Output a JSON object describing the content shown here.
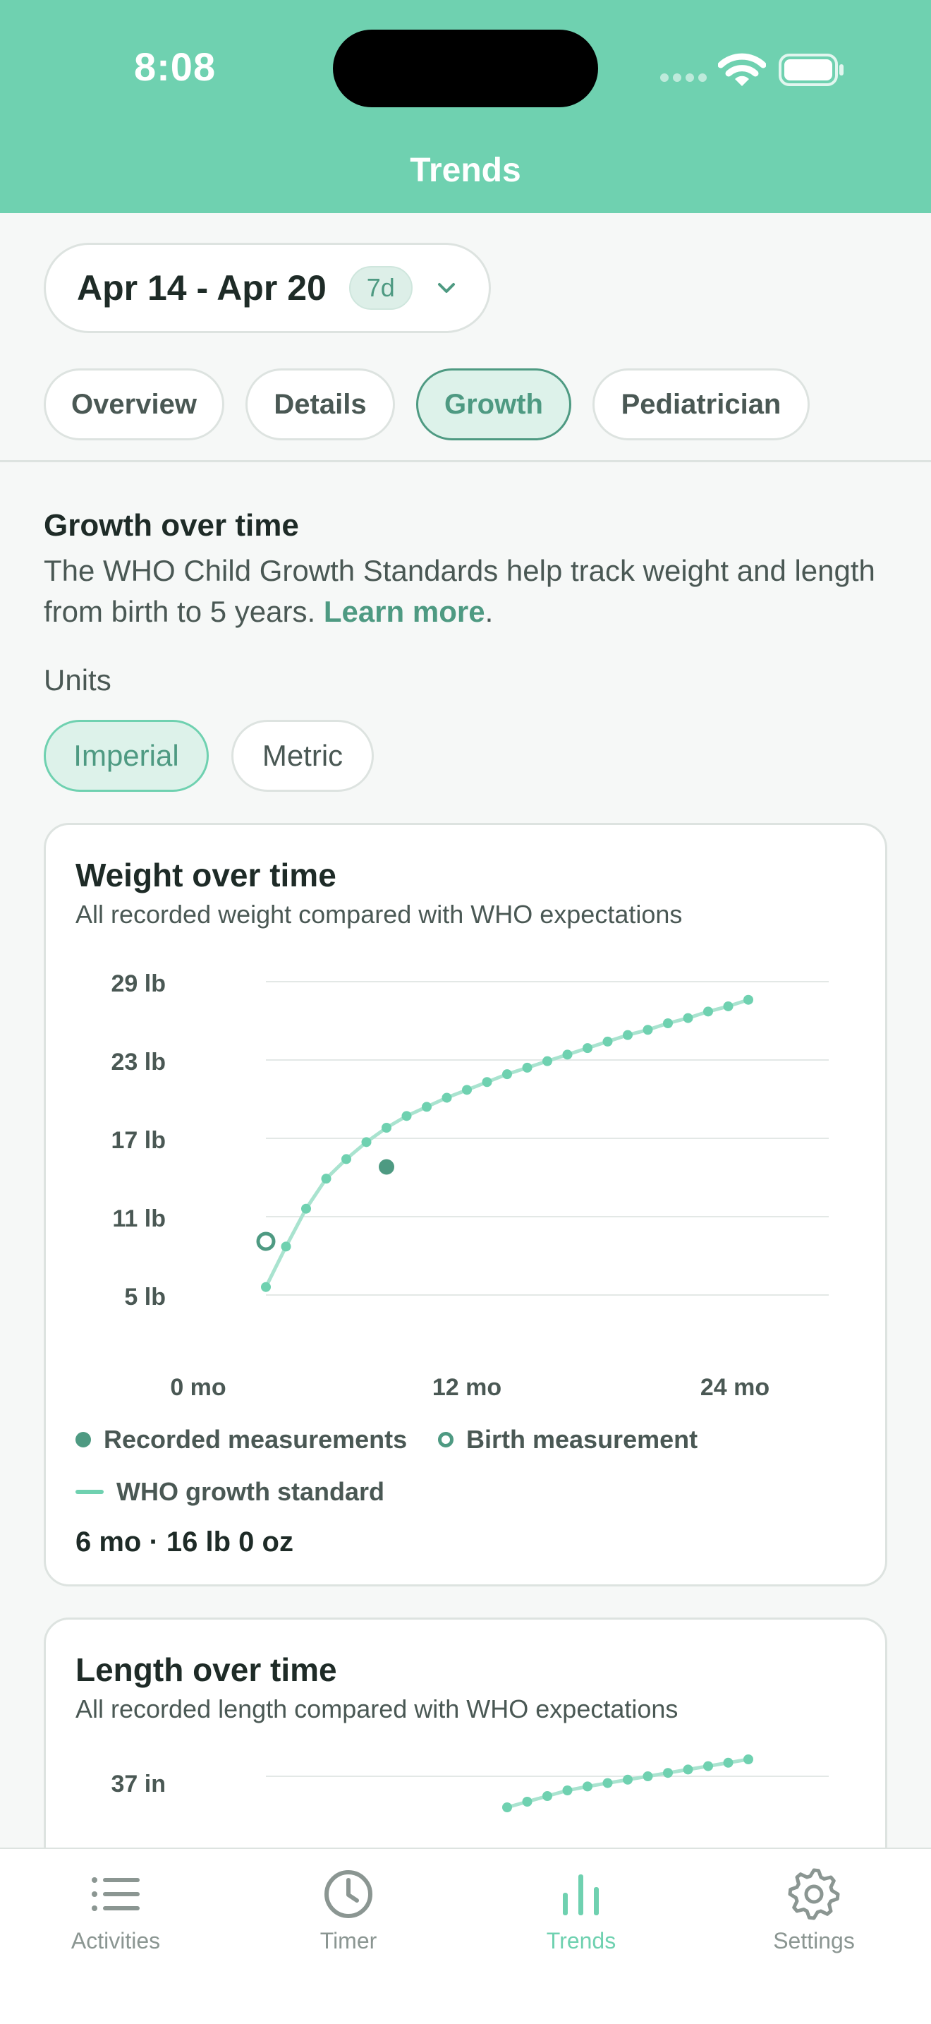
{
  "status_bar": {
    "time": "8:08"
  },
  "header": {
    "title": "Trends"
  },
  "date_range": {
    "label": "Apr 14 - Apr 20",
    "badge": "7d"
  },
  "tabs": [
    {
      "label": "Overview",
      "active": false
    },
    {
      "label": "Details",
      "active": false
    },
    {
      "label": "Growth",
      "active": true
    },
    {
      "label": "Pediatrician",
      "active": false
    }
  ],
  "growth": {
    "title": "Growth over time",
    "description": "The WHO Child Growth Standards help track weight and length from birth to 5 years.",
    "learn_more": "Learn more",
    "description_end": ".",
    "units_label": "Units",
    "units": [
      {
        "label": "Imperial",
        "active": true
      },
      {
        "label": "Metric",
        "active": false
      }
    ]
  },
  "weight_card": {
    "title": "Weight over time",
    "subtitle": "All recorded weight compared with WHO expectations",
    "legend": {
      "recorded": "Recorded measurements",
      "birth": "Birth measurement",
      "standard": "WHO growth standard"
    },
    "selected": "6 mo · 16 lb 0 oz"
  },
  "length_card": {
    "title": "Length over time",
    "subtitle": "All recorded length compared with WHO expectations"
  },
  "bottom_nav": [
    {
      "label": "Activities",
      "icon": "list-icon",
      "active": false
    },
    {
      "label": "Timer",
      "icon": "clock-icon",
      "active": false
    },
    {
      "label": "Trends",
      "icon": "bar-chart-icon",
      "active": true
    },
    {
      "label": "Settings",
      "icon": "gear-icon",
      "active": false
    }
  ],
  "colors": {
    "header_bg": "#6FD1B0",
    "accent": "#4E9A82",
    "curve": "#6FD1B0",
    "page_bg": "#F6F8F7"
  },
  "chart_data": [
    {
      "type": "line",
      "title": "Weight over time",
      "y_unit": "lb",
      "y_ticks": [
        "29 lb",
        "23 lb",
        "17 lb",
        "11 lb",
        "5 lb"
      ],
      "x_ticks": [
        "0 mo",
        "12 mo",
        "24 mo"
      ],
      "ylim": [
        5,
        29
      ],
      "xlim": [
        0,
        24
      ],
      "grid": true,
      "series": [
        {
          "name": "WHO growth standard",
          "x": [
            1,
            2,
            3,
            4,
            5,
            6,
            7,
            8,
            9,
            10,
            11,
            12,
            13,
            14,
            15,
            16,
            17,
            18,
            19,
            20,
            21,
            22,
            23,
            24,
            25
          ],
          "y": [
            6.8,
            9.9,
            12.8,
            15.1,
            16.6,
            17.9,
            19.0,
            19.9,
            20.6,
            21.3,
            21.9,
            22.5,
            23.1,
            23.6,
            24.1,
            24.6,
            25.1,
            25.6,
            26.1,
            26.5,
            27.0,
            27.4,
            27.9,
            28.3,
            28.8
          ]
        },
        {
          "name": "Recorded measurements",
          "x": [
            7
          ],
          "y": [
            16.0
          ]
        },
        {
          "name": "Birth measurement",
          "x": [
            1
          ],
          "y": [
            10.3
          ]
        }
      ]
    },
    {
      "type": "line",
      "title": "Length over time",
      "y_unit": "in",
      "y_ticks": [
        "37 in"
      ],
      "series": [
        {
          "name": "WHO growth standard",
          "x": [
            13,
            14,
            15,
            16,
            17,
            18,
            19,
            20,
            21,
            22,
            23,
            24,
            25
          ],
          "y": [
            36.45,
            36.55,
            36.65,
            36.75,
            36.82,
            36.88,
            36.94,
            37.0,
            37.06,
            37.12,
            37.18,
            37.24,
            37.3
          ]
        }
      ]
    }
  ]
}
